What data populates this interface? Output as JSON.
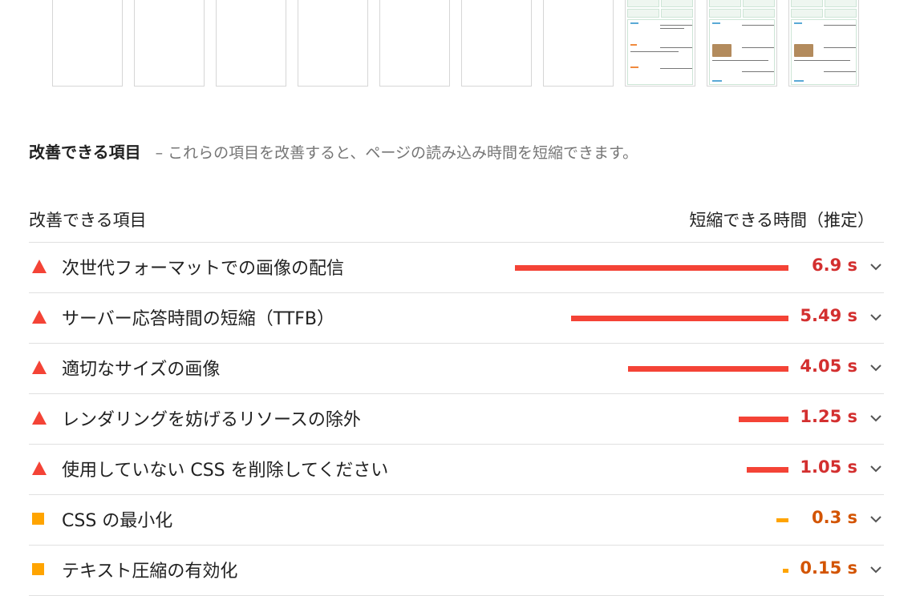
{
  "colors": {
    "fail": "#f44336",
    "fail_text": "#d32f2f",
    "average": "#ffa400",
    "average_text": "#d35400"
  },
  "filmstrip": {
    "thumb_texts": [
      [
        "営業時間",
        "1990",
        "Zetta",
        "営業"
      ],
      [
        "Google AdSense で気を付ける点"
      ],
      [
        "Webを使って仕事をする方法"
      ],
      [
        "Crossのオプションの追加"
      ]
    ]
  },
  "section": {
    "title": "改善できる項目",
    "description": "– これらの項目を改善すると、ページの読み込み時間を短縮できます。"
  },
  "table": {
    "col_left": "改善できる項目",
    "col_right": "短縮できる時間（推定）",
    "rows": [
      {
        "title": "次世代フォーマットでの画像の配信",
        "value": "6.9 s",
        "seconds": 6.9,
        "severity": "fail"
      },
      {
        "title": "サーバー応答時間の短縮（TTFB）",
        "value": "5.49 s",
        "seconds": 5.49,
        "severity": "fail"
      },
      {
        "title": "適切なサイズの画像",
        "value": "4.05 s",
        "seconds": 4.05,
        "severity": "fail"
      },
      {
        "title": "レンダリングを妨げるリソースの除外",
        "value": "1.25 s",
        "seconds": 1.25,
        "severity": "fail"
      },
      {
        "title": "使用していない CSS を削除してください",
        "value": "1.05 s",
        "seconds": 1.05,
        "severity": "fail"
      },
      {
        "title": "CSS の最小化",
        "value": "0.3 s",
        "seconds": 0.3,
        "severity": "average"
      },
      {
        "title": "テキスト圧縮の有効化",
        "value": "0.15 s",
        "seconds": 0.15,
        "severity": "average"
      }
    ]
  }
}
